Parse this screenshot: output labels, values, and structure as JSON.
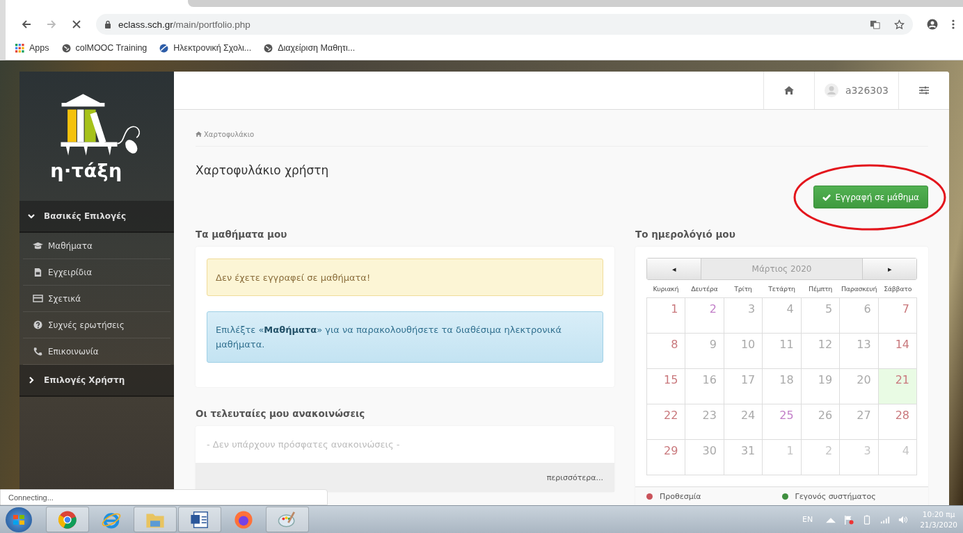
{
  "browser": {
    "url_host": "eclass.sch.gr",
    "url_path": "/main/portfolio.php",
    "loading": true,
    "bookmarks": [
      {
        "label": "Apps"
      },
      {
        "label": "colMOOC Training"
      },
      {
        "label": "Ηλεκτρονική Σχολι..."
      },
      {
        "label": "Διαχείριση Μαθητι..."
      }
    ],
    "status": "Connecting..."
  },
  "logo": {
    "text": "η·τάξη"
  },
  "sidebar": [
    {
      "label": "Βασικές Επιλογές",
      "expanded": true,
      "children": [
        {
          "label": "Μαθήματα"
        },
        {
          "label": "Εγχειρίδια"
        },
        {
          "label": "Σχετικά"
        },
        {
          "label": "Συχνές ερωτήσεις"
        },
        {
          "label": "Επικοινωνία"
        }
      ]
    },
    {
      "label": "Επιλογές Χρήστη",
      "expanded": false
    }
  ],
  "header": {
    "username": "a326303"
  },
  "breadcrumb": "Χαρτοφυλάκιο",
  "title": "Χαρτοφυλάκιο χρήστη",
  "enroll_button": {
    "label": "Εγγραφή σε μάθημα",
    "circled": true
  },
  "courses": {
    "heading": "Τα μαθήματα μου",
    "warning": "Δεν έχετε εγγραφεί σε μαθήματα!",
    "info": "Επιλέξτε «**Μαθήματα**» για να παρακολουθήσετε τα διαθέσιμα ηλεκτρονικά μαθήματα."
  },
  "announcements": {
    "heading": "Οι τελευταίες μου ανακοινώσεις",
    "empty": "- Δεν υπάρχουν πρόσφατες ανακοινώσεις -",
    "more": "περισσότερα..."
  },
  "calendar": {
    "heading": "Το ημερολόγιό μου",
    "prev": "◂",
    "next": "▸",
    "month": "Μάρτιος 2020",
    "weekdays": [
      "Κυριακή",
      "Δευτέρα",
      "Τρίτη",
      "Τετάρτη",
      "Πέμπτη",
      "Παρασκευή",
      "Σάββατο"
    ],
    "weeks": [
      {
        "days": [
          {
            "day": "1",
            "kind": "weekend",
            "today": false
          },
          {
            "day": "2",
            "kind": "event",
            "today": false
          },
          {
            "day": "3",
            "kind": "weekday",
            "today": false
          },
          {
            "day": "4",
            "kind": "weekday",
            "today": false
          },
          {
            "day": "5",
            "kind": "weekday",
            "today": false
          },
          {
            "day": "6",
            "kind": "weekday",
            "today": false
          },
          {
            "day": "7",
            "kind": "weekend",
            "today": false
          }
        ]
      },
      {
        "days": [
          {
            "day": "8",
            "kind": "weekend",
            "today": false
          },
          {
            "day": "9",
            "kind": "weekday",
            "today": false
          },
          {
            "day": "10",
            "kind": "weekday",
            "today": false
          },
          {
            "day": "11",
            "kind": "weekday",
            "today": false
          },
          {
            "day": "12",
            "kind": "weekday",
            "today": false
          },
          {
            "day": "13",
            "kind": "weekday",
            "today": false
          },
          {
            "day": "14",
            "kind": "weekend",
            "today": false
          }
        ]
      },
      {
        "days": [
          {
            "day": "15",
            "kind": "weekend",
            "today": false
          },
          {
            "day": "16",
            "kind": "weekday",
            "today": false
          },
          {
            "day": "17",
            "kind": "weekday",
            "today": false
          },
          {
            "day": "18",
            "kind": "weekday",
            "today": false
          },
          {
            "day": "19",
            "kind": "weekday",
            "today": false
          },
          {
            "day": "20",
            "kind": "weekday",
            "today": false
          },
          {
            "day": "21",
            "kind": "weekend",
            "today": true
          }
        ]
      },
      {
        "days": [
          {
            "day": "22",
            "kind": "weekend",
            "today": false
          },
          {
            "day": "23",
            "kind": "weekday",
            "today": false
          },
          {
            "day": "24",
            "kind": "weekday",
            "today": false
          },
          {
            "day": "25",
            "kind": "event",
            "today": false
          },
          {
            "day": "26",
            "kind": "weekday",
            "today": false
          },
          {
            "day": "27",
            "kind": "weekday",
            "today": false
          },
          {
            "day": "28",
            "kind": "weekend",
            "today": false
          }
        ]
      },
      {
        "days": [
          {
            "day": "29",
            "kind": "weekend",
            "today": false
          },
          {
            "day": "30",
            "kind": "weekday",
            "today": false
          },
          {
            "day": "31",
            "kind": "weekday",
            "today": false
          },
          {
            "day": "1",
            "kind": "other_month",
            "today": false
          },
          {
            "day": "2",
            "kind": "other_month",
            "today": false
          },
          {
            "day": "3",
            "kind": "other_month",
            "today": false
          },
          {
            "day": "4",
            "kind": "other_month",
            "today": false
          }
        ]
      }
    ],
    "legend": [
      {
        "label": "Προθεσμία",
        "color": "#c9525a"
      },
      {
        "label": "Γεγονός συστήματος",
        "color": "#3f8f3f"
      }
    ]
  },
  "taskbar": {
    "language": "EN",
    "time": "10:20 πμ",
    "date": "21/3/2020"
  }
}
